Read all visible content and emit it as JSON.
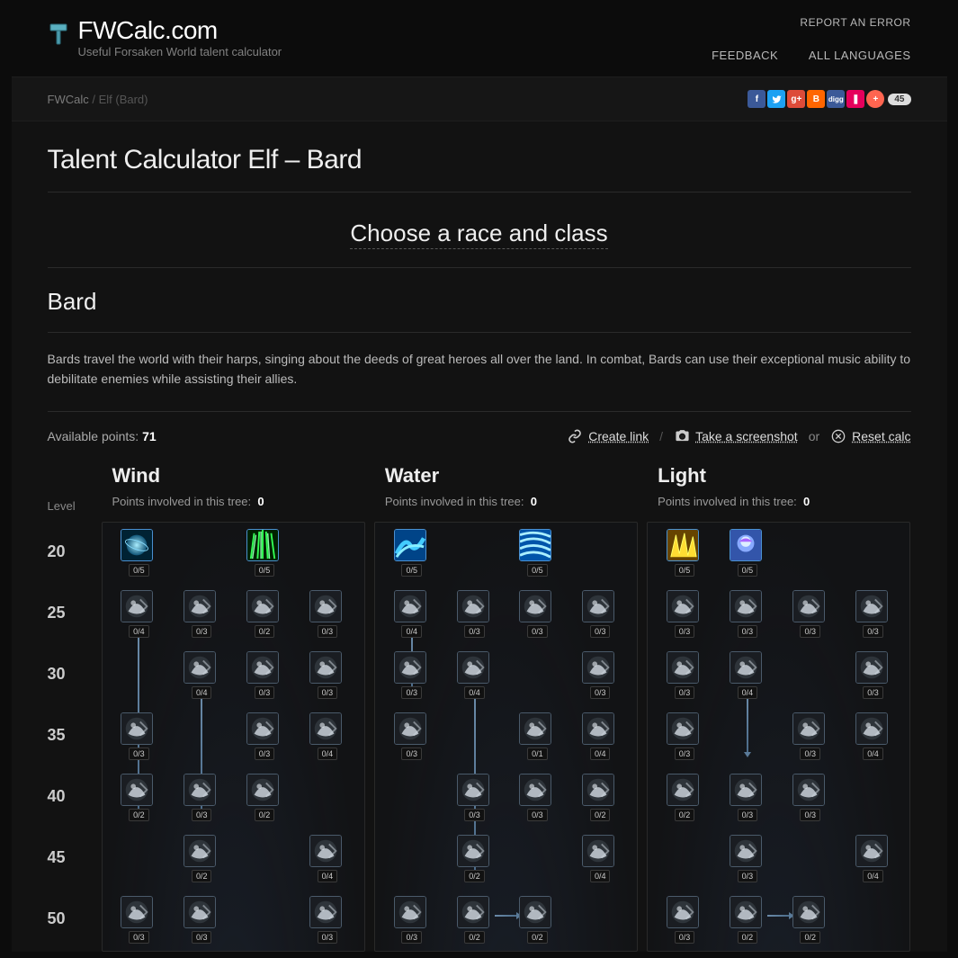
{
  "site": {
    "name": "FWCalc.com",
    "tagline": "Useful Forsaken World talent calculator"
  },
  "nav": {
    "report": "REPORT AN ERROR",
    "feedback": "FEEDBACK",
    "lang": "ALL LANGUAGES"
  },
  "breadcrumb": {
    "root": "FWCalc",
    "current": "Elf (Bard)"
  },
  "share_count": "45",
  "page_title": "Talent Calculator Elf – Bard",
  "choose_label": "Choose a race and class",
  "class_name": "Bard",
  "class_desc": "Bards travel the world with their harps, singing about the deeds of great heroes all over the land. In combat, Bards can use their exceptional music ability to debilitate enemies while assisting their allies.",
  "available_label": "Available points:",
  "available_points": "71",
  "actions": {
    "create": "Create link",
    "screenshot": "Take a screenshot",
    "or": "or",
    "reset": "Reset calc"
  },
  "level_label": "Level",
  "levels": [
    "20",
    "25",
    "30",
    "35",
    "40",
    "45",
    "50"
  ],
  "points_label": "Points involved in this tree:",
  "trees": [
    {
      "name": "Wind",
      "points": "0",
      "rows": [
        [
          {
            "v": "0/5",
            "c": 1,
            "s": "wind1"
          },
          null,
          {
            "v": "0/5",
            "c": 1,
            "s": "wind2"
          },
          null
        ],
        [
          {
            "v": "0/4",
            "s": "t",
            "arr_d": 200
          },
          {
            "v": "0/3",
            "s": "t"
          },
          {
            "v": "0/2",
            "s": "t"
          },
          {
            "v": "0/3",
            "s": "t"
          }
        ],
        [
          null,
          {
            "v": "0/4",
            "s": "t",
            "arr_d": 132
          },
          {
            "v": "0/3",
            "s": "t"
          },
          {
            "v": "0/3",
            "s": "t"
          }
        ],
        [
          {
            "v": "0/3",
            "s": "t"
          },
          null,
          {
            "v": "0/3",
            "s": "t"
          },
          {
            "v": "0/4",
            "s": "t"
          }
        ],
        [
          {
            "v": "0/2",
            "s": "t"
          },
          {
            "v": "0/3",
            "s": "t"
          },
          {
            "v": "0/2",
            "s": "t"
          },
          null
        ],
        [
          null,
          {
            "v": "0/2",
            "s": "t"
          },
          null,
          {
            "v": "0/4",
            "s": "t"
          }
        ],
        [
          {
            "v": "0/3",
            "s": "t"
          },
          {
            "v": "0/3",
            "s": "t"
          },
          null,
          {
            "v": "0/3",
            "s": "t"
          }
        ]
      ]
    },
    {
      "name": "Water",
      "points": "0",
      "rows": [
        [
          {
            "v": "0/5",
            "c": 1,
            "s": "water1"
          },
          null,
          {
            "v": "0/5",
            "c": 1,
            "s": "water2"
          },
          null
        ],
        [
          {
            "v": "0/4",
            "s": "t",
            "arr_d": 64
          },
          {
            "v": "0/3",
            "s": "t"
          },
          {
            "v": "0/3",
            "s": "t"
          },
          {
            "v": "0/3",
            "s": "t"
          }
        ],
        [
          {
            "v": "0/3",
            "s": "t"
          },
          {
            "v": "0/4",
            "s": "t",
            "arr_d": 200
          },
          null,
          {
            "v": "0/3",
            "s": "t"
          }
        ],
        [
          {
            "v": "0/3",
            "s": "t"
          },
          null,
          {
            "v": "0/1",
            "s": "t"
          },
          {
            "v": "0/4",
            "s": "t"
          }
        ],
        [
          null,
          {
            "v": "0/3",
            "s": "t"
          },
          {
            "v": "0/3",
            "s": "t"
          },
          {
            "v": "0/2",
            "s": "t"
          }
        ],
        [
          null,
          {
            "v": "0/2",
            "s": "t"
          },
          null,
          {
            "v": "0/4",
            "s": "t"
          }
        ],
        [
          {
            "v": "0/3",
            "s": "t"
          },
          {
            "v": "0/2",
            "s": "t",
            "arr_r": 1
          },
          {
            "v": "0/2",
            "s": "t"
          },
          null
        ]
      ]
    },
    {
      "name": "Light",
      "points": "0",
      "rows": [
        [
          {
            "v": "0/5",
            "c": 1,
            "s": "light1"
          },
          {
            "v": "0/5",
            "c": 1,
            "s": "light2"
          },
          null,
          null
        ],
        [
          {
            "v": "0/3",
            "s": "t"
          },
          {
            "v": "0/3",
            "s": "t"
          },
          {
            "v": "0/3",
            "s": "t"
          },
          {
            "v": "0/3",
            "s": "t"
          }
        ],
        [
          {
            "v": "0/3",
            "s": "t"
          },
          {
            "v": "0/4",
            "s": "t",
            "arr_d": 64
          },
          null,
          {
            "v": "0/3",
            "s": "t"
          }
        ],
        [
          {
            "v": "0/3",
            "s": "t"
          },
          null,
          {
            "v": "0/3",
            "s": "t"
          },
          {
            "v": "0/4",
            "s": "t"
          }
        ],
        [
          {
            "v": "0/2",
            "s": "t"
          },
          {
            "v": "0/3",
            "s": "t"
          },
          {
            "v": "0/3",
            "s": "t"
          },
          null
        ],
        [
          null,
          {
            "v": "0/3",
            "s": "t"
          },
          null,
          {
            "v": "0/4",
            "s": "t"
          }
        ],
        [
          {
            "v": "0/3",
            "s": "t"
          },
          {
            "v": "0/2",
            "s": "t",
            "arr_r": 1
          },
          {
            "v": "0/2",
            "s": "t"
          },
          null
        ]
      ]
    }
  ]
}
